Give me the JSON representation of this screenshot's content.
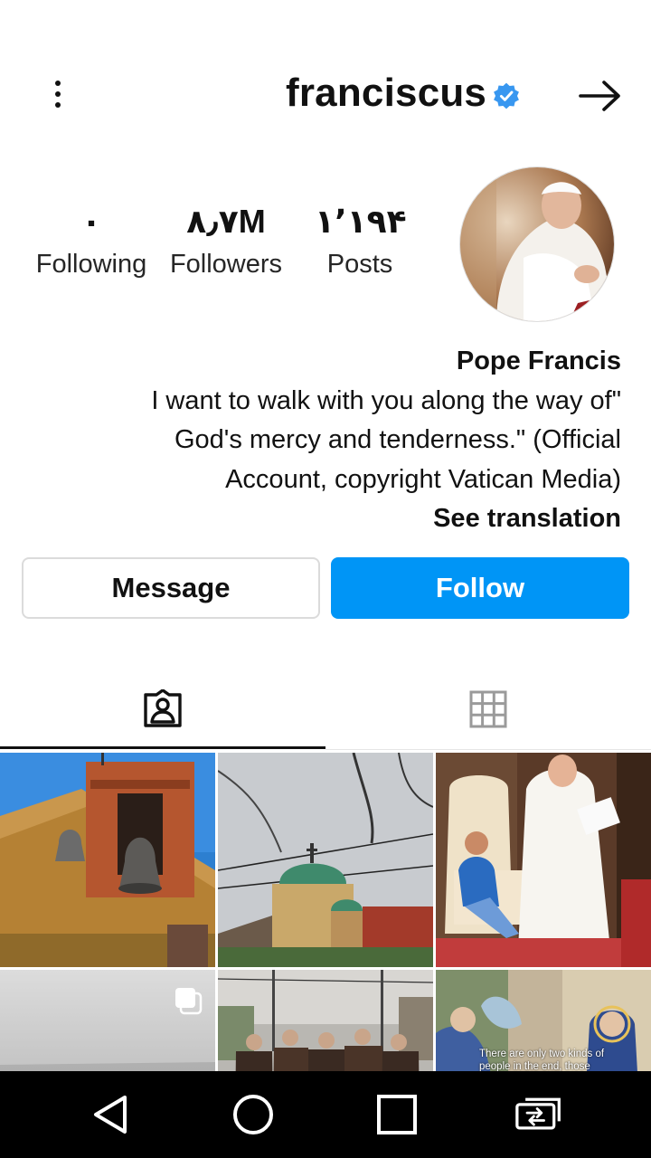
{
  "header": {
    "username": "franciscus",
    "verified": true,
    "menu_icon": "more-vertical-icon",
    "back_icon": "arrow-right-icon"
  },
  "stats": {
    "following": {
      "value": "۰",
      "label": "Following"
    },
    "followers": {
      "value": "۸٫۷M",
      "label": "Followers"
    },
    "posts": {
      "value": "۱٬۱۹۴",
      "label": "Posts"
    }
  },
  "bio": {
    "name": "Pope Francis",
    "lines": [
      "I want to walk with you along the way of\"",
      "God's mercy and tenderness.\" (Official",
      "Account, copyright Vatican Media)"
    ],
    "see_translation": "See translation"
  },
  "actions": {
    "message_label": "Message",
    "follow_label": "Follow"
  },
  "tabs": [
    {
      "id": "tagged",
      "icon": "tagged-person-icon",
      "active": true
    },
    {
      "id": "grid",
      "icon": "grid-icon",
      "active": false
    }
  ],
  "grid_posts": [
    {
      "subject": "bell-tower"
    },
    {
      "subject": "church-domes"
    },
    {
      "subject": "pope-with-child"
    },
    {
      "subject": "cloudy-sky",
      "multiple": true
    },
    {
      "subject": "group-of-friars"
    },
    {
      "subject": "painting",
      "caption": "There are only two kinds of people in the end, those"
    }
  ],
  "navbar": {
    "back_icon": "nav-back-icon",
    "home_icon": "nav-home-icon",
    "recents_icon": "nav-recents-icon",
    "extra_icon": "nav-screen-switch-icon"
  },
  "colors": {
    "accent": "#0095f6",
    "verified": "#3897f0",
    "navbar": "#000000"
  }
}
